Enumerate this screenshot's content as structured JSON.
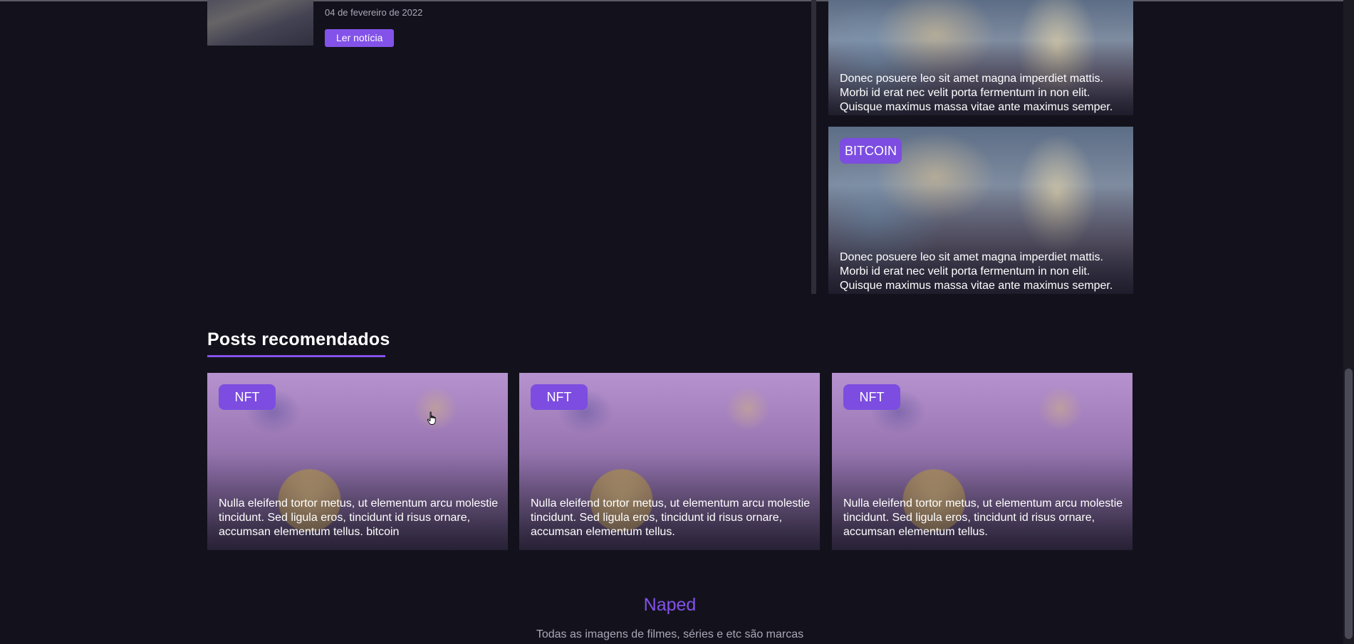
{
  "article": {
    "date": "04 de fevereiro de 2022",
    "button_label": "Ler notícia"
  },
  "sidebar": {
    "cards": [
      {
        "tag": "",
        "text": "Donec posuere leo sit amet magna imperdiet mattis. Morbi id erat nec velit porta fermentum in non elit. Quisque maximus massa vitae ante maximus semper."
      },
      {
        "tag": "BITCOIN",
        "text": "Donec posuere leo sit amet magna imperdiet mattis. Morbi id erat nec velit porta fermentum in non elit. Quisque maximus massa vitae ante maximus semper."
      }
    ]
  },
  "recommended": {
    "title": "Posts recomendados",
    "cards": [
      {
        "tag": "NFT",
        "text": "Nulla eleifend tortor metus, ut elementum arcu molestie tincidunt. Sed ligula eros, tincidunt id risus ornare, accumsan elementum tellus. bitcoin"
      },
      {
        "tag": "NFT",
        "text": "Nulla eleifend tortor metus, ut elementum arcu molestie tincidunt. Sed ligula eros, tincidunt id risus ornare, accumsan elementum tellus."
      },
      {
        "tag": "NFT",
        "text": "Nulla eleifend tortor metus, ut elementum arcu molestie tincidunt. Sed ligula eros, tincidunt id risus ornare, accumsan elementum tellus."
      }
    ]
  },
  "footer": {
    "brand": "Naped",
    "note": "Todas as imagens de filmes, séries e etc são marcas"
  },
  "colors": {
    "accent": "#8352e9",
    "background": "#13121c"
  }
}
